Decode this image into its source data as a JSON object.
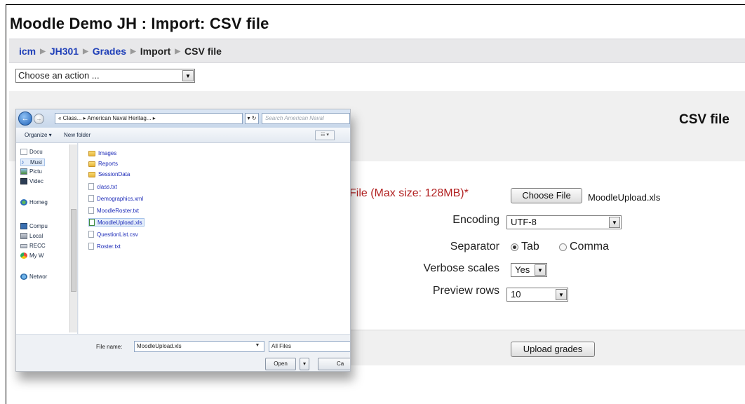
{
  "page": {
    "title": "Moodle Demo JH : Import: CSV file",
    "breadcrumb": [
      {
        "label": "icm",
        "link": true
      },
      {
        "label": "JH301",
        "link": true
      },
      {
        "label": "Grades",
        "link": true
      },
      {
        "label": "Import",
        "link": false
      },
      {
        "label": "CSV file",
        "link": false
      }
    ],
    "action_select": {
      "value": "Choose an action ..."
    },
    "section_title": "CSV file"
  },
  "form": {
    "file_label": "File (Max size: 128MB)",
    "required_marker": "*",
    "choose_file_button": "Choose File",
    "chosen_file": "MoodleUpload.xls",
    "encoding_label": "Encoding",
    "encoding_value": "UTF-8",
    "separator_label": "Separator",
    "separator_options": [
      {
        "label": "Tab",
        "checked": true
      },
      {
        "label": "Comma",
        "checked": false
      }
    ],
    "verbose_label": "Verbose scales",
    "verbose_value": "Yes",
    "preview_label": "Preview rows",
    "preview_value": "10",
    "upload_button": "Upload grades"
  },
  "dialog": {
    "path": "« Class... ▸ American Naval Heritag... ▸",
    "search_placeholder": "Search American Naval",
    "toolbar": {
      "organize": "Organize ▾",
      "new_folder": "New folder",
      "view": "☷ ▾"
    },
    "nav_items": [
      {
        "label": "Docu",
        "icon": "documents-icon"
      },
      {
        "label": "Musi",
        "icon": "music-icon"
      },
      {
        "label": "Pictu",
        "icon": "pictures-icon"
      },
      {
        "label": "Videc",
        "icon": "videos-icon"
      },
      {
        "label": "Homeg",
        "icon": "homegroup-icon"
      },
      {
        "label": "Compu",
        "icon": "computer-icon"
      },
      {
        "label": "Local",
        "icon": "local-disk-icon"
      },
      {
        "label": "RECC",
        "icon": "drive-icon"
      },
      {
        "label": "My W",
        "icon": "web-icon"
      },
      {
        "label": "Networ",
        "icon": "network-icon"
      }
    ],
    "files": [
      {
        "name": "Images",
        "type": "folder"
      },
      {
        "name": "Reports",
        "type": "folder"
      },
      {
        "name": "SessionData",
        "type": "folder"
      },
      {
        "name": "class.txt",
        "type": "file"
      },
      {
        "name": "Demographics.xml",
        "type": "file"
      },
      {
        "name": "MoodleRoster.txt",
        "type": "file"
      },
      {
        "name": "MoodleUpload.xls",
        "type": "file",
        "selected": true
      },
      {
        "name": "QuestionList.csv",
        "type": "file"
      },
      {
        "name": "Roster.txt",
        "type": "file"
      }
    ],
    "file_name_label": "File name:",
    "file_name_value": "MoodleUpload.xls",
    "filter_value": "All Files",
    "open_button": "Open",
    "cancel_button": "Ca"
  },
  "colors": {
    "link": "#1f3fb8",
    "required": "#b22222",
    "navbar_bg": "#e8e8ea",
    "panel_bg": "#f0f0f0"
  }
}
